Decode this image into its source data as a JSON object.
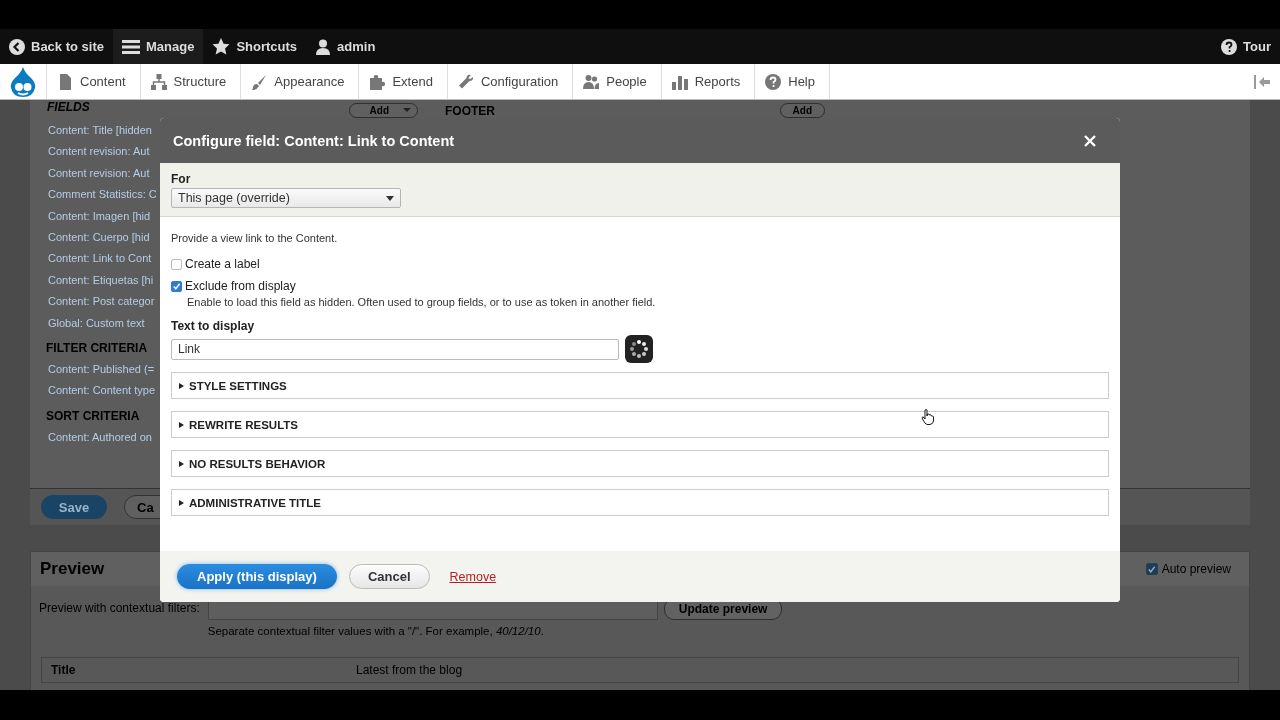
{
  "toolbar": {
    "items": [
      {
        "label": "Back to site"
      },
      {
        "label": "Manage"
      },
      {
        "label": "Shortcuts"
      },
      {
        "label": "admin"
      }
    ],
    "tour": "Tour"
  },
  "tray": {
    "items": [
      {
        "label": "Content"
      },
      {
        "label": "Structure"
      },
      {
        "label": "Appearance"
      },
      {
        "label": "Extend"
      },
      {
        "label": "Configuration"
      },
      {
        "label": "People"
      },
      {
        "label": "Reports"
      },
      {
        "label": "Help"
      }
    ]
  },
  "background": {
    "fields_heading": "FIELDS",
    "fields_add": "Add",
    "footer_heading": "FOOTER",
    "footer_add": "Add",
    "fields": [
      "Content: Title [hidden",
      "Content revision: Aut",
      "Content revision: Aut",
      "Comment Statistics: C",
      "Content: Imagen [hid",
      "Content: Cuerpo [hid",
      "Content: Link to Cont",
      "Content: Etiquetas [hi",
      "Content: Post categor",
      "Global: Custom text"
    ],
    "filter_heading": "FILTER CRITERIA",
    "filters": [
      "Content: Published (=",
      "Content: Content type"
    ],
    "sort_heading": "SORT CRITERIA",
    "sorts": [
      "Content: Authored on"
    ],
    "save": "Save",
    "cancel": "Ca",
    "preview": {
      "title": "Preview",
      "auto_preview": {
        "label": "Auto preview",
        "checked": true
      },
      "filter_label": "Preview with contextual filters:",
      "update": "Update preview",
      "hint": "Separate contextual filter values with a \"/\". For example, *40/12/10*.",
      "columns": [
        "Title",
        "Latest from the blog"
      ]
    }
  },
  "dialog": {
    "title": "Configure field: Content: Link to Content",
    "for_label": "For",
    "for_value": "This page (override)",
    "description": "Provide a view link to the Content.",
    "checkboxes": [
      {
        "label": "Create a label",
        "checked": false
      },
      {
        "label": "Exclude from display",
        "checked": true,
        "help": "Enable to load this field as hidden. Often used to group fields, or to use as token in another field."
      }
    ],
    "text_label": "Text to display",
    "text_value": "Link",
    "sections": [
      {
        "label": "STYLE SETTINGS",
        "expanded": false
      },
      {
        "label": "REWRITE RESULTS",
        "expanded": false
      },
      {
        "label": "NO RESULTS BEHAVIOR",
        "expanded": false
      },
      {
        "label": "ADMINISTRATIVE TITLE",
        "expanded": false
      }
    ],
    "apply": "Apply (this display)",
    "cancel": "Cancel",
    "remove": "Remove"
  }
}
